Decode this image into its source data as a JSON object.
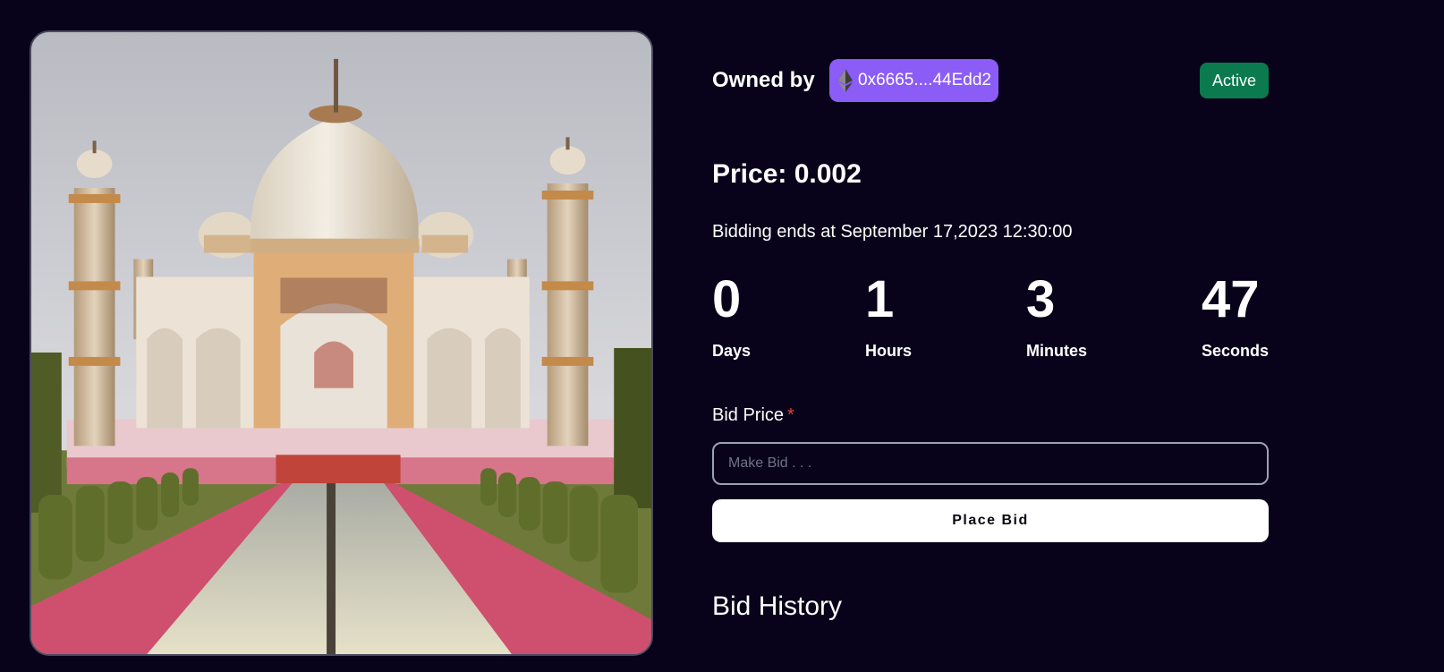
{
  "nft": {
    "image_alt": "Taj Mahal"
  },
  "owner": {
    "label": "Owned by",
    "address": "0x6665....44Edd2",
    "chain_icon": "ethereum-icon"
  },
  "status": {
    "label": "Active",
    "color": "#0c7a4f"
  },
  "price": {
    "text": "Price: 0.002"
  },
  "auction": {
    "ends_text": "Bidding ends at September 17,2023 12:30:00"
  },
  "countdown": {
    "days": {
      "value": "0",
      "label": "Days"
    },
    "hours": {
      "value": "1",
      "label": "Hours"
    },
    "minutes": {
      "value": "3",
      "label": "Minutes"
    },
    "seconds": {
      "value": "47",
      "label": "Seconds"
    }
  },
  "bid_form": {
    "label": "Bid Price",
    "required_mark": "*",
    "placeholder": "Make Bid . . .",
    "value": "",
    "submit_label": "Place Bid"
  },
  "history": {
    "title": "Bid History"
  },
  "colors": {
    "background": "#08031a",
    "owner_chip": "#8b5cf6",
    "accent_green": "#0c7a4f"
  }
}
